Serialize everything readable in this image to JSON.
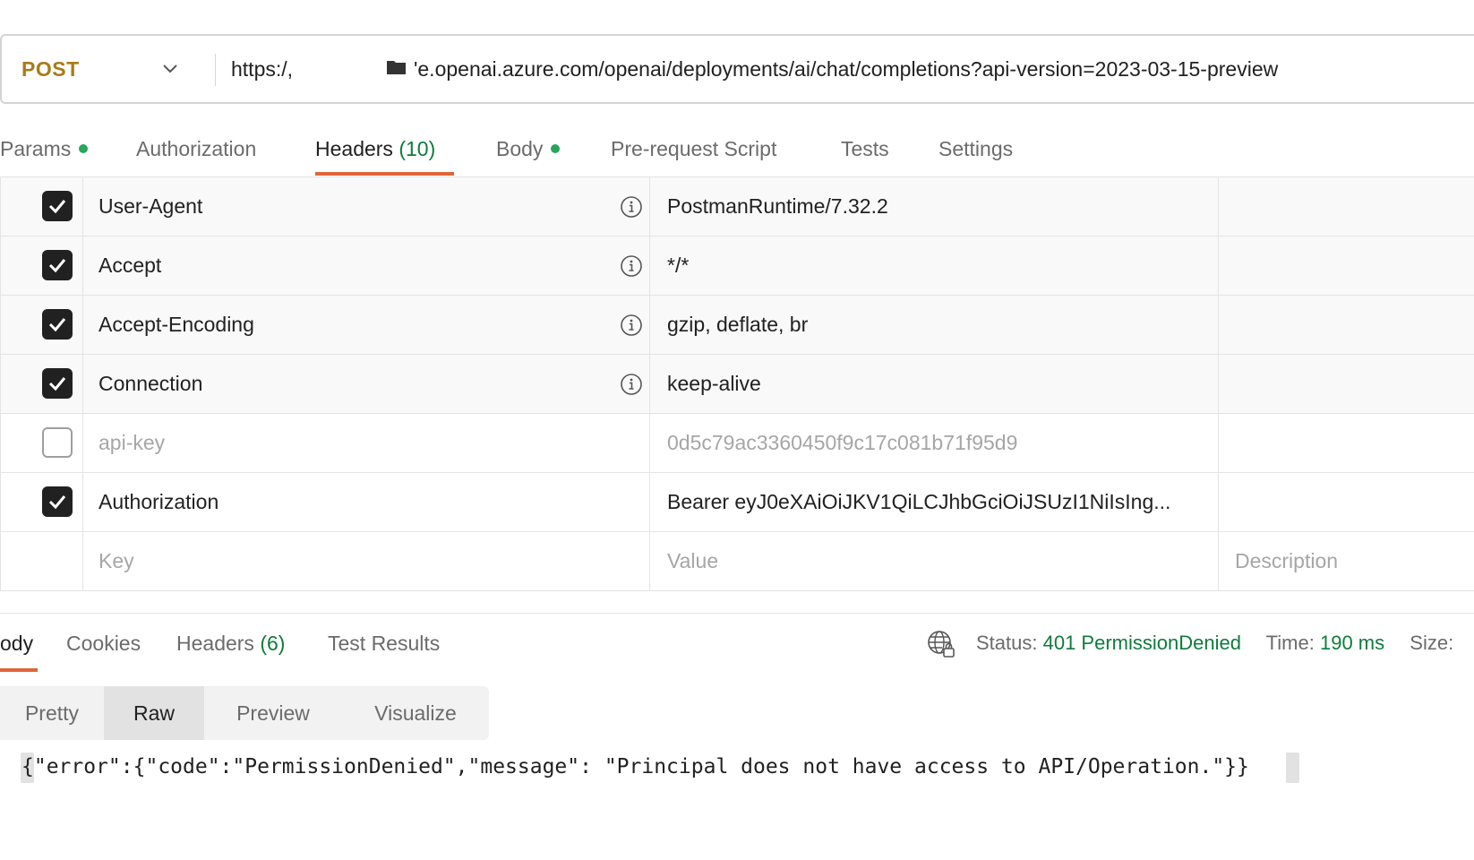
{
  "request": {
    "method": "POST",
    "url_prefix": "https:/,",
    "url_rest": "'e.openai.azure.com/openai/deployments/ai/chat/completions?api-version=2023-03-15-preview"
  },
  "request_tabs": [
    {
      "label": "Params",
      "dot": true
    },
    {
      "label": "Authorization",
      "dot": false
    },
    {
      "label": "Headers",
      "count": "(10)",
      "active": true
    },
    {
      "label": "Body",
      "dot": true
    },
    {
      "label": "Pre-request Script"
    },
    {
      "label": "Tests"
    },
    {
      "label": "Settings"
    }
  ],
  "headers_table": {
    "rows": [
      {
        "checked": true,
        "key": "User-Agent",
        "value": "PostmanRuntime/7.32.2",
        "info": true
      },
      {
        "checked": true,
        "key": "Accept",
        "value": "*/*",
        "info": true
      },
      {
        "checked": true,
        "key": "Accept-Encoding",
        "value": "gzip, deflate, br",
        "info": true
      },
      {
        "checked": true,
        "key": "Connection",
        "value": "keep-alive",
        "info": true
      },
      {
        "checked": false,
        "key": "api-key",
        "value": "0d5c79ac3360450f9c17c081b71f95d9",
        "info": false
      },
      {
        "checked": true,
        "key": "Authorization",
        "value": "Bearer eyJ0eXAiOiJKV1QiLCJhbGciOiJSUzI1NiIsIng...",
        "info": false
      }
    ],
    "placeholder": {
      "key": "Key",
      "value": "Value",
      "description": "Description"
    }
  },
  "response_tabs": [
    {
      "label": "ody",
      "active": true
    },
    {
      "label": "Cookies"
    },
    {
      "label": "Headers",
      "count": "(6)"
    },
    {
      "label": "Test Results"
    }
  ],
  "status": {
    "status_label": "Status:",
    "status_value": "401 PermissionDenied",
    "time_label": "Time:",
    "time_value": "190 ms",
    "size_label": "Size:"
  },
  "view_modes": [
    "Pretty",
    "Raw",
    "Preview",
    "Visualize"
  ],
  "active_view": "Raw",
  "response_body": "{\"error\":{\"code\":\"PermissionDenied\",\"message\": \"Principal does not have access to API/Operation.\"}}",
  "colors": {
    "accent": "#e0653b",
    "method": "#a87b1b",
    "success_green": "#0f7b3c",
    "dot_green": "#26a65b"
  },
  "icons": [
    "chevron-down-icon",
    "folder-icon",
    "info-icon",
    "checkbox-checked-icon",
    "globe-lock-icon"
  ]
}
